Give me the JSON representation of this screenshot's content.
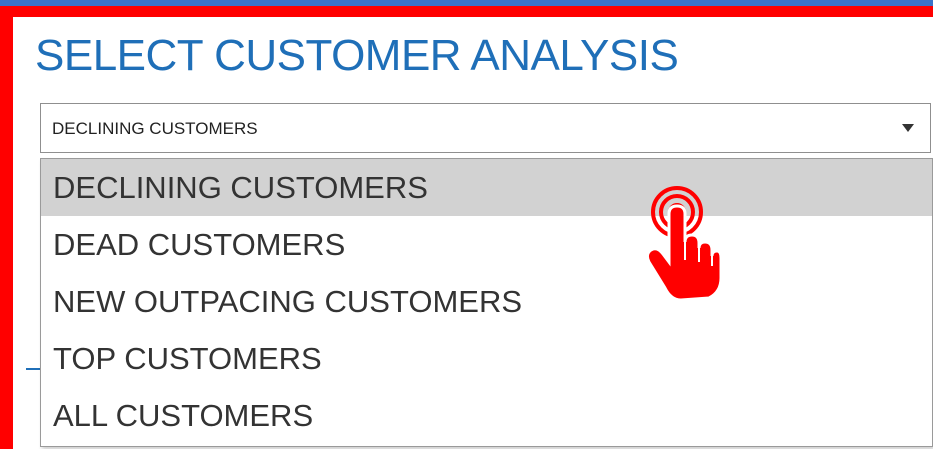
{
  "title": "SELECT CUSTOMER ANALYSIS",
  "select": {
    "value": "DECLINING CUSTOMERS",
    "arrow_icon": "caret-down-icon"
  },
  "dropdown": {
    "options": [
      {
        "label": "DECLINING CUSTOMERS",
        "selected": true
      },
      {
        "label": "DEAD CUSTOMERS",
        "selected": false
      },
      {
        "label": "NEW OUTPACING CUSTOMERS",
        "selected": false
      },
      {
        "label": "TOP CUSTOMERS",
        "selected": false
      },
      {
        "label": "ALL CUSTOMERS",
        "selected": false
      }
    ]
  },
  "cursor": {
    "icon": "hand-pointer-icon",
    "color": "#ff0000"
  },
  "colors": {
    "outer_background": "#3b73c8",
    "frame_border": "#ff0000",
    "title": "#1f6fb8",
    "selected_option": "#d2d2d2"
  }
}
